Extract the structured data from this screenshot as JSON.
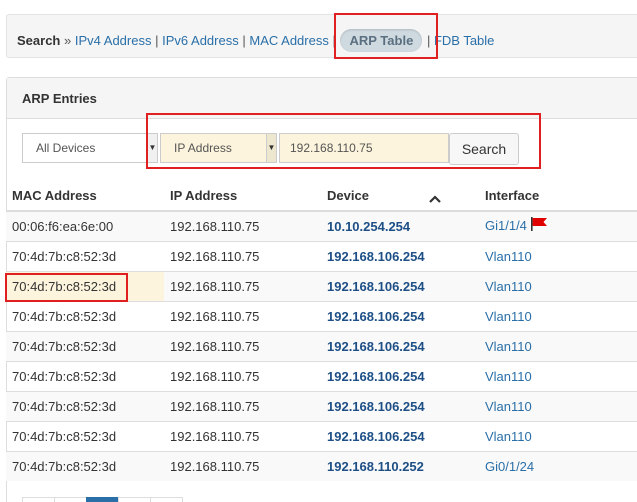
{
  "breadcrumb": {
    "search_label": "Search",
    "separator": "»",
    "items": [
      {
        "label": "IPv4 Address"
      },
      {
        "label": "IPv6 Address"
      },
      {
        "label": "MAC Address"
      },
      {
        "label": "ARP Table"
      },
      {
        "label": "FDB Table"
      }
    ],
    "divider": "|"
  },
  "panel": {
    "title": "ARP Entries"
  },
  "filter": {
    "device_select": "All Devices",
    "field_select": "IP Address",
    "search_value": "192.168.110.75",
    "search_button": "Search"
  },
  "table": {
    "headers": {
      "mac": "MAC Address",
      "ip": "IP Address",
      "device": "Device",
      "interface": "Interface"
    },
    "rows": [
      {
        "mac": "00:06:f6:ea:6e:00",
        "ip": "192.168.110.75",
        "device": "10.10.254.254",
        "interface": "Gi1/1/4"
      },
      {
        "mac": "70:4d:7b:c8:52:3d",
        "ip": "192.168.110.75",
        "device": "192.168.106.254",
        "interface": "Vlan110"
      },
      {
        "mac": "70:4d:7b:c8:52:3d",
        "ip": "192.168.110.75",
        "device": "192.168.106.254",
        "interface": "Vlan110"
      },
      {
        "mac": "70:4d:7b:c8:52:3d",
        "ip": "192.168.110.75",
        "device": "192.168.106.254",
        "interface": "Vlan110"
      },
      {
        "mac": "70:4d:7b:c8:52:3d",
        "ip": "192.168.110.75",
        "device": "192.168.106.254",
        "interface": "Vlan110"
      },
      {
        "mac": "70:4d:7b:c8:52:3d",
        "ip": "192.168.110.75",
        "device": "192.168.106.254",
        "interface": "Vlan110"
      },
      {
        "mac": "70:4d:7b:c8:52:3d",
        "ip": "192.168.110.75",
        "device": "192.168.106.254",
        "interface": "Vlan110"
      },
      {
        "mac": "70:4d:7b:c8:52:3d",
        "ip": "192.168.110.75",
        "device": "192.168.106.254",
        "interface": "Vlan110"
      },
      {
        "mac": "70:4d:7b:c8:52:3d",
        "ip": "192.168.110.75",
        "device": "192.168.110.252",
        "interface": "Gi0/1/24"
      }
    ]
  },
  "colors": {
    "link": "#2a6fa8",
    "device_link": "#1d4f86",
    "highlight_box": "#e02020",
    "input_highlight": "#fcf4dc",
    "flag": "#e00000"
  },
  "icons": {
    "sort": "chevron-up-icon",
    "flag": "flag-icon",
    "caret": "caret-down-icon"
  }
}
